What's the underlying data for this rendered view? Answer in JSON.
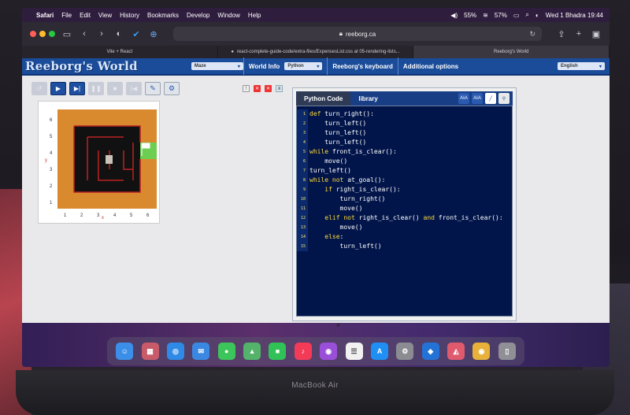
{
  "menubar": {
    "app": "Safari",
    "items": [
      "File",
      "Edit",
      "View",
      "History",
      "Bookmarks",
      "Develop",
      "Window",
      "Help"
    ],
    "volume": "55%",
    "battery": "57%",
    "datetime": "Wed 1 Bhadra 19:44"
  },
  "browser": {
    "url": "reeborg.ca",
    "tabs": [
      {
        "title": "Vite + React"
      },
      {
        "title": "react-complete-guide-code/extra-files/ExpensesList.css at 05-rendering-lists..."
      },
      {
        "title": "Reeborg's World"
      }
    ]
  },
  "reeborg": {
    "title": "Reeborg's World",
    "world_select": "Maze",
    "world_info": "World Info",
    "language_select": "Python",
    "keyboard": "Reeborg's keyboard",
    "additional": "Additional options",
    "ui_language": "English"
  },
  "world": {
    "x_ticks": [
      "1",
      "2",
      "3",
      "4",
      "5",
      "6"
    ],
    "y_ticks": [
      "1",
      "2",
      "3",
      "4",
      "5",
      "6"
    ],
    "x_label": "x",
    "y_label": "y"
  },
  "editor": {
    "tabs": [
      "Python Code",
      "library"
    ],
    "tool_labels": [
      "AIA",
      "AIA"
    ],
    "lines": [
      {
        "n": "1",
        "code": "def turn_right():"
      },
      {
        "n": "2",
        "code": "    turn_left()"
      },
      {
        "n": "3",
        "code": "    turn_left()"
      },
      {
        "n": "4",
        "code": "    turn_left()"
      },
      {
        "n": "5",
        "code": "while front_is_clear():"
      },
      {
        "n": "6",
        "code": "    move()"
      },
      {
        "n": "7",
        "code": "turn_left()"
      },
      {
        "n": "8",
        "code": "while not at_goal():"
      },
      {
        "n": "9",
        "code": "    if right_is_clear():"
      },
      {
        "n": "10",
        "code": "        turn_right()"
      },
      {
        "n": "11",
        "code": "        move()"
      },
      {
        "n": "12",
        "code": "    elif not right_is_clear() and front_is_clear():"
      },
      {
        "n": "13",
        "code": "        move()"
      },
      {
        "n": "14",
        "code": "    else:"
      },
      {
        "n": "15",
        "code": "        turn_left()"
      }
    ]
  },
  "laptop_label": "MacBook Air",
  "dock": [
    {
      "name": "finder-icon",
      "color": "#3b8fe8",
      "glyph": "☺"
    },
    {
      "name": "launchpad-icon",
      "color": "#c85b6a",
      "glyph": "▦"
    },
    {
      "name": "safari-icon",
      "color": "#2f89e6",
      "glyph": "◎"
    },
    {
      "name": "mail-icon",
      "color": "#3a88e2",
      "glyph": "✉"
    },
    {
      "name": "messages-icon",
      "color": "#3cc55a",
      "glyph": "●"
    },
    {
      "name": "maps-icon",
      "color": "#53b36a",
      "glyph": "▲"
    },
    {
      "name": "facetime-icon",
      "color": "#31c257",
      "glyph": "■"
    },
    {
      "name": "music-icon",
      "color": "#f33b58",
      "glyph": "♪"
    },
    {
      "name": "podcasts-icon",
      "color": "#9a4fd8",
      "glyph": "◉"
    },
    {
      "name": "reminders-icon",
      "color": "#f1f1f1",
      "glyph": "☰"
    },
    {
      "name": "app-store-icon",
      "color": "#1f8ff3",
      "glyph": "A"
    },
    {
      "name": "system-settings-icon",
      "color": "#8b8c92",
      "glyph": "⚙"
    },
    {
      "name": "vscode-icon",
      "color": "#2373d6",
      "glyph": "◆"
    },
    {
      "name": "gitkraken-icon",
      "color": "#e05a6e",
      "glyph": "◭"
    },
    {
      "name": "chrome-icon",
      "color": "#e7b13a",
      "glyph": "◉"
    },
    {
      "name": "trash-icon",
      "color": "#8f8f95",
      "glyph": "▯"
    }
  ]
}
